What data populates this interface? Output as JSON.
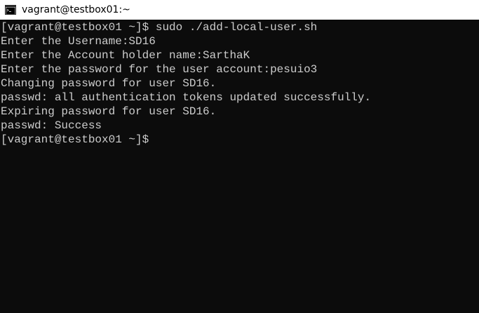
{
  "window": {
    "title": "vagrant@testbox01:~",
    "icon": "console-icon"
  },
  "terminal": {
    "lines": [
      "[vagrant@testbox01 ~]$ sudo ./add-local-user.sh",
      "Enter the Username:SD16",
      "Enter the Account holder name:SarthaK",
      "Enter the password for the user account:pesuio3",
      "Changing password for user SD16.",
      "passwd: all authentication tokens updated successfully.",
      "Expiring password for user SD16.",
      "passwd: Success",
      "[vagrant@testbox01 ~]$"
    ],
    "background": "#0c0c0c",
    "foreground": "#cccccc"
  }
}
